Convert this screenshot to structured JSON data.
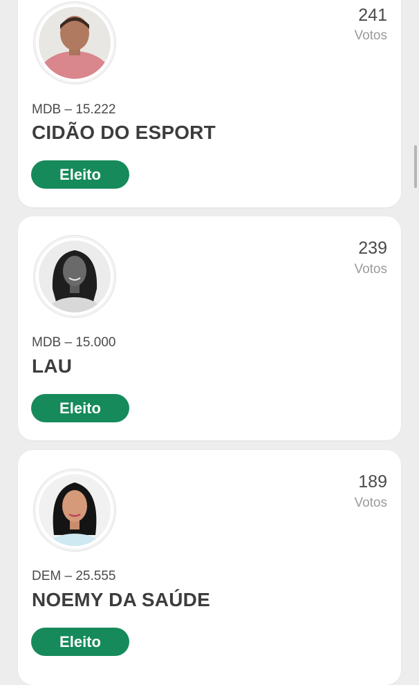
{
  "candidates": [
    {
      "votes": "241",
      "votes_label": "Votos",
      "party": "MDB – 15.222",
      "name": "CIDÃO DO ESPORT",
      "status": "Eleito",
      "photo": "photo-man-pink-shirt"
    },
    {
      "votes": "239",
      "votes_label": "Votos",
      "party": "MDB – 15.000",
      "name": "LAU",
      "status": "Eleito",
      "photo": "photo-woman-grayscale"
    },
    {
      "votes": "189",
      "votes_label": "Votos",
      "party": "DEM – 25.555",
      "name": "NOEMY DA SAÚDE",
      "status": "Eleito",
      "photo": "photo-woman-dark-hair"
    }
  ],
  "colors": {
    "badge": "#168a5a",
    "background": "#ededed",
    "card": "#ffffff"
  }
}
